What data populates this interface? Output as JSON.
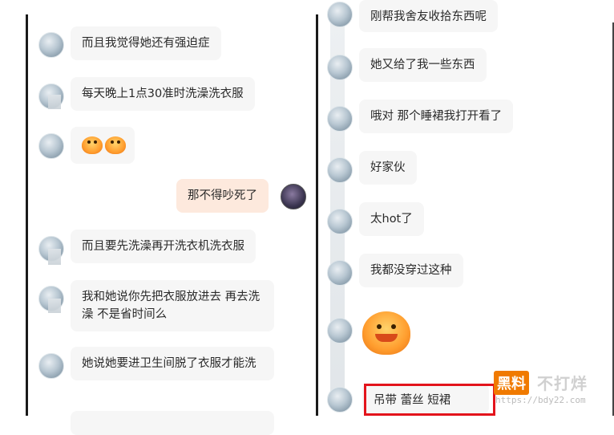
{
  "left_chat": {
    "messages": [
      {
        "text": "而且我觉得她还有强迫症",
        "from": "other"
      },
      {
        "text": "每天晚上1点30准时洗澡洗衣服",
        "from": "other"
      },
      {
        "text": "",
        "from": "other",
        "emoji": "crab-emoji-pair"
      },
      {
        "text": "那不得吵死了",
        "from": "me"
      },
      {
        "text": "而且要先洗澡再开洗衣机洗衣服",
        "from": "other"
      },
      {
        "text": "我和她说你先把衣服放进去 再去洗澡 不是省时间么",
        "from": "other"
      },
      {
        "text": "她说她要进卫生间脱了衣服才能洗",
        "from": "other"
      }
    ]
  },
  "right_chat": {
    "messages": [
      {
        "text": "刚帮我舍友收拾东西呢",
        "from": "other"
      },
      {
        "text": "她又给了我一些东西",
        "from": "other"
      },
      {
        "text": "哦对 那个睡裙我打开看了",
        "from": "other"
      },
      {
        "text": "好家伙",
        "from": "other"
      },
      {
        "text": "太hot了",
        "from": "other"
      },
      {
        "text": "我都没穿过这种",
        "from": "other"
      },
      {
        "text": "",
        "from": "other",
        "emoji": "crab-emoji-large"
      },
      {
        "text": "吊带 蕾丝 短裙",
        "from": "other",
        "highlighted": true
      }
    ]
  },
  "watermark": {
    "logo": "黑料",
    "text": "不打烊",
    "url": "https://bdy22.com"
  },
  "colors": {
    "bubble_other": "#f6f6f6",
    "bubble_me": "#fde9dd",
    "highlight": "#e3141c",
    "watermark_logo": "#f07a00"
  }
}
